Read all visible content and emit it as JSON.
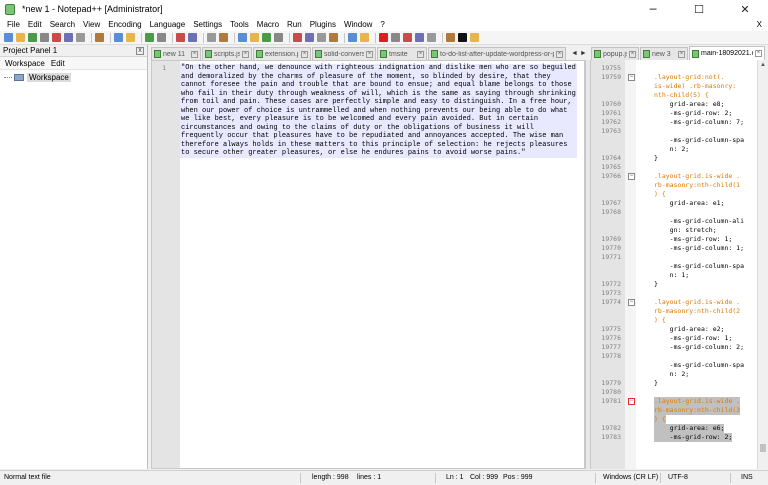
{
  "window": {
    "title": "*new 1 - Notepad++ [Administrator]",
    "minimize_glyph": "─",
    "maximize_glyph": "☐",
    "close_glyph": "✕"
  },
  "menu": {
    "items": [
      "File",
      "Edit",
      "Search",
      "View",
      "Encoding",
      "Language",
      "Settings",
      "Tools",
      "Macro",
      "Run",
      "Plugins",
      "Window",
      "?"
    ],
    "close_glyph": "X"
  },
  "toolbar": {
    "icons": [
      "new-file-icon",
      "open-file-icon",
      "save-icon",
      "save-all-icon",
      "close-icon",
      "close-all-icon",
      "print-icon",
      "cut-icon",
      "copy-icon",
      "paste-icon",
      "undo-icon",
      "redo-icon",
      "find-icon",
      "replace-icon",
      "zoom-in-icon",
      "zoom-out-icon",
      "sync-vertical-icon",
      "sync-horizontal-icon",
      "word-wrap-icon",
      "show-all-chars-icon",
      "indent-guide-icon",
      "language-icon",
      "document-map-icon",
      "function-list-icon",
      "folder-workspace-icon",
      "monitoring-icon",
      "record-macro-icon",
      "stop-macro-icon",
      "play-macro-icon",
      "run-macro-multiple-icon",
      "save-macro-icon",
      "spell-check-icon",
      "plugin-j-icon",
      "plugin-settings-icon"
    ]
  },
  "project_panel": {
    "title": "Project Panel 1",
    "close_glyph": "x",
    "menu": [
      "Workspace",
      "Edit"
    ],
    "tree_root": "Workspace"
  },
  "tabs_left": [
    {
      "label": "new 11",
      "active": false
    },
    {
      "label": "scripts.js",
      "active": false
    },
    {
      "label": "extension.js",
      "active": false
    },
    {
      "label": "solid-conversion.js",
      "active": false
    },
    {
      "label": "tmsite",
      "active": false
    },
    {
      "label": "to-do-list-after-update-wordpress-or-plugin.txt",
      "active": false
    }
  ],
  "tab_arrows": "◄ ►",
  "tabs_right": [
    {
      "label": "popup.js",
      "active": false
    },
    {
      "label": "new 3",
      "active": false
    },
    {
      "label": "main-18092021.css",
      "active": true
    }
  ],
  "editor_left": {
    "line_number": "1",
    "text": "\"On the other hand, we denounce with righteous indignation and dislike men who are so beguiled and demoralized by the charms of pleasure of the moment, so blinded by desire, that they cannot foresee the pain and trouble that are bound to ensue; and equal blame belongs to those who fail in their duty through weakness of will, which is the same as saying through shrinking from toil and pain. These cases are perfectly simple and easy to distinguish. In a free hour, when our power of choice is untrammelled and when nothing prevents our being able to do what we like best, every pleasure is to be welcomed and every pain avoided. But in certain circumstances and owing to the claims of duty or the obligations of business it will frequently occur that pleasures have to be repudiated and annoyances accepted. The wise man therefore always holds in these matters to this principle of selection: he rejects pleasures to secure other greater pleasures, or else he endures pains to avoid worse pains.\""
  },
  "editor_right": {
    "lines": [
      {
        "num": "19755",
        "code": ""
      },
      {
        "num": "19759",
        "code": ".layout-grid:not(.",
        "kind": "sel",
        "fold": "open"
      },
      {
        "num": "",
        "code": "is-wide) .rb-masonry:",
        "kind": "sel"
      },
      {
        "num": "",
        "code": "nth-child(5) {",
        "kind": "sel"
      },
      {
        "num": "19760",
        "code": "    grid-area: e8;"
      },
      {
        "num": "19761",
        "code": "    -ms-grid-row: 2;"
      },
      {
        "num": "19762",
        "code": "    -ms-grid-column: 7;"
      },
      {
        "num": "19763",
        "code": ""
      },
      {
        "num": "",
        "code": "    -ms-grid-column-spa"
      },
      {
        "num": "",
        "code": "    n: 2;"
      },
      {
        "num": "19764",
        "code": "}"
      },
      {
        "num": "19765",
        "code": ""
      },
      {
        "num": "19766",
        "code": ".layout-grid.is-wide .",
        "kind": "sel",
        "fold": "open"
      },
      {
        "num": "",
        "code": "rb-masonry:nth-child(1",
        "kind": "sel"
      },
      {
        "num": "",
        "code": ") {",
        "kind": "sel"
      },
      {
        "num": "19767",
        "code": "    grid-area: e1;"
      },
      {
        "num": "19768",
        "code": ""
      },
      {
        "num": "",
        "code": "    -ms-grid-column-ali"
      },
      {
        "num": "",
        "code": "    gn: stretch;"
      },
      {
        "num": "19769",
        "code": "    -ms-grid-row: 1;"
      },
      {
        "num": "19770",
        "code": "    -ms-grid-column: 1;"
      },
      {
        "num": "19771",
        "code": ""
      },
      {
        "num": "",
        "code": "    -ms-grid-column-spa"
      },
      {
        "num": "",
        "code": "    n: 1;"
      },
      {
        "num": "19772",
        "code": "}"
      },
      {
        "num": "19773",
        "code": ""
      },
      {
        "num": "19774",
        "code": ".layout-grid.is-wide .",
        "kind": "sel",
        "fold": "open"
      },
      {
        "num": "",
        "code": "rb-masonry:nth-child(2",
        "kind": "sel"
      },
      {
        "num": "",
        "code": ") {",
        "kind": "sel"
      },
      {
        "num": "19775",
        "code": "    grid-area: e2;"
      },
      {
        "num": "19776",
        "code": "    -ms-grid-row: 1;"
      },
      {
        "num": "19777",
        "code": "    -ms-grid-column: 2;"
      },
      {
        "num": "19778",
        "code": ""
      },
      {
        "num": "",
        "code": "    -ms-grid-column-spa"
      },
      {
        "num": "",
        "code": "    n: 2;"
      },
      {
        "num": "19779",
        "code": "}"
      },
      {
        "num": "19780",
        "code": ""
      },
      {
        "num": "19781",
        "code": ".layout-grid.is-wide .",
        "kind": "sel",
        "fold": "red",
        "hl": true
      },
      {
        "num": "",
        "code": "rb-masonry:nth-child(3",
        "kind": "sel",
        "hl": true
      },
      {
        "num": "",
        "code": ") {",
        "kind": "sel",
        "hl": true
      },
      {
        "num": "19782",
        "code": "    grid-area: e6;",
        "hl": true
      },
      {
        "num": "19783",
        "code": "    -ms-grid-row: 2;",
        "hl": true
      }
    ],
    "scroll_up": "▲",
    "scroll_down": "▼"
  },
  "status": {
    "file_type": "Normal text file",
    "length": "length : 998",
    "lines": "lines : 1",
    "ln": "Ln : 1",
    "col": "Col : 999",
    "pos": "Pos : 999",
    "eol": "Windows (CR LF)",
    "encoding": "UTF-8",
    "mode": "INS"
  },
  "colors": {
    "selector": "#e07a00",
    "selection_bg": "#e8e8ff",
    "gutter_bg": "#e4e4e4",
    "highlight_bg": "#c0c0c0"
  }
}
